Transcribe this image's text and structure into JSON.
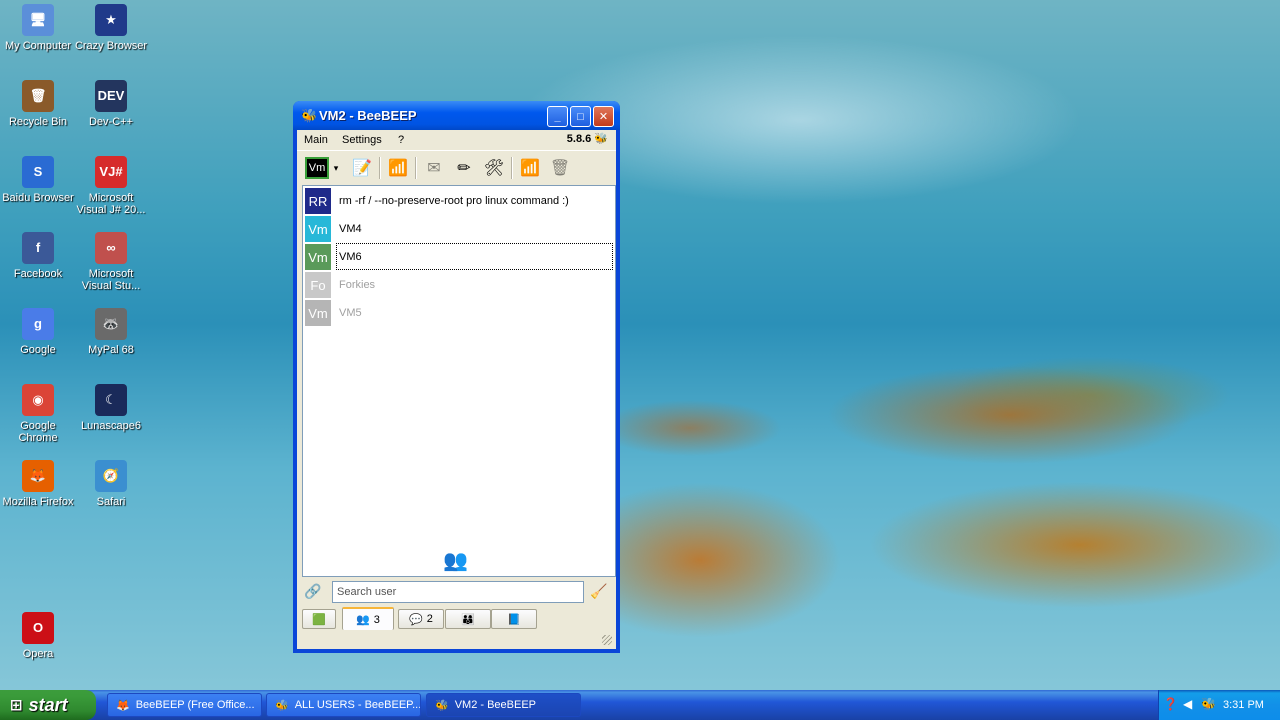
{
  "desktop": {
    "icons": [
      {
        "label": "My Computer",
        "icon": "computer-icon",
        "color": "#5b8fd9",
        "glyph": "🖥"
      },
      {
        "label": "Crazy Browser",
        "icon": "crazy-browser-icon",
        "color": "#203a8a",
        "glyph": "★"
      },
      {
        "label": "Recycle Bin",
        "icon": "recycle-bin-icon",
        "color": "#8a5a2a",
        "glyph": "🗑"
      },
      {
        "label": "Dev-C++",
        "icon": "dev-cpp-icon",
        "color": "#23355e",
        "glyph": "DEV"
      },
      {
        "label": "Baidu Browser",
        "icon": "baidu-browser-icon",
        "color": "#2a6bd3",
        "glyph": "S"
      },
      {
        "label": "Microsoft Visual J# 20...",
        "icon": "visual-jsharp-icon",
        "color": "#d62b2b",
        "glyph": "VJ#"
      },
      {
        "label": "Facebook",
        "icon": "facebook-icon",
        "color": "#3b5998",
        "glyph": "f"
      },
      {
        "label": "Microsoft Visual Stu...",
        "icon": "visual-studio-icon",
        "color": "#c0504d",
        "glyph": "∞"
      },
      {
        "label": "Google",
        "icon": "google-icon",
        "color": "#4a7ce8",
        "glyph": "g"
      },
      {
        "label": "MyPal 68",
        "icon": "mypal-icon",
        "color": "#6a6a6a",
        "glyph": "🦝"
      },
      {
        "label": "Google Chrome",
        "icon": "chrome-icon",
        "color": "#db4437",
        "glyph": "◉"
      },
      {
        "label": "Lunascape6",
        "icon": "lunascape-icon",
        "color": "#1a2a5a",
        "glyph": "☾"
      },
      {
        "label": "Mozilla Firefox",
        "icon": "firefox-icon",
        "color": "#e66000",
        "glyph": "🦊"
      },
      {
        "label": "Safari",
        "icon": "safari-icon",
        "color": "#3b8fd0",
        "glyph": "🧭"
      },
      {
        "label": "Opera",
        "icon": "opera-icon",
        "color": "#cc0f16",
        "glyph": "O"
      }
    ]
  },
  "window": {
    "title": "VM2 - BeeBEEP",
    "menu": [
      "Main",
      "Settings",
      "?"
    ],
    "version": "5.8.6",
    "toolbar_profile": "Vm"
  },
  "users": [
    {
      "initials": "RR",
      "name": "rm -rf / --no-preserve-root pro linux command :)",
      "color": "#1f2a8a",
      "status": "online"
    },
    {
      "initials": "Vm",
      "name": "VM4",
      "color": "#27b8d8",
      "status": "online"
    },
    {
      "initials": "Vm",
      "name": "VM6",
      "color": "#5a9a5a",
      "status": "online"
    },
    {
      "initials": "Fo",
      "name": "Forkies",
      "color": "#c8c8c8",
      "status": "offline"
    },
    {
      "initials": "Vm",
      "name": "VM5",
      "color": "#b5b5b5",
      "status": "offline"
    }
  ],
  "search": {
    "placeholder": "Search user"
  },
  "tabs": [
    {
      "icon": "chat-window-icon",
      "count": ""
    },
    {
      "icon": "users-icon",
      "count": "3"
    },
    {
      "icon": "chats-icon",
      "count": "2"
    },
    {
      "icon": "groups-icon",
      "count": ""
    },
    {
      "icon": "file-share-icon",
      "count": ""
    }
  ],
  "taskbar": {
    "start_label": "start",
    "tasks": [
      {
        "label": "BeeBEEP (Free Office...",
        "active": false
      },
      {
        "label": "ALL USERS - BeeBEEP...",
        "active": false
      },
      {
        "label": "VM2 - BeeBEEP",
        "active": true
      }
    ],
    "clock": "3:31 PM"
  }
}
